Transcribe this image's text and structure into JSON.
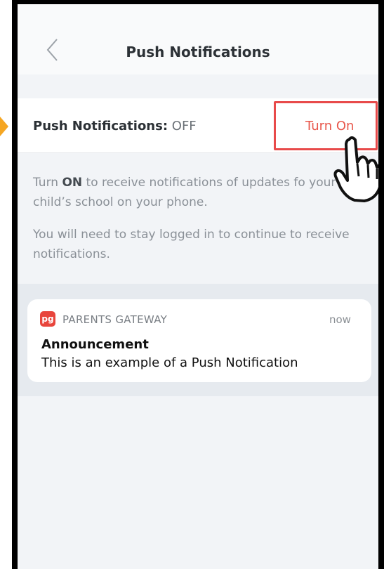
{
  "header": {
    "title": "Push Notifications"
  },
  "setting": {
    "label": "Push Notifications:",
    "status": "OFF",
    "action": "Turn On"
  },
  "description": {
    "line1_prefix": "Turn ",
    "line1_bold": "ON",
    "line1_suffix": " to receive notifications of updates fo your child’s school on your phone.",
    "line2": "You will need to stay logged in to continue to receive notifications."
  },
  "notification": {
    "app_icon_text": "pg",
    "app_name": "PARENTS GATEWAY",
    "time": "now",
    "title": "Announcement",
    "body": "This is an example of a Push Notification"
  },
  "colors": {
    "accent": "#e8574b",
    "highlight_border": "#e84a4a",
    "arrow": "#f5a623",
    "app_icon": "#e8453c"
  },
  "icons": {
    "back": "chevron-left-icon",
    "pointer": "hand-pointer-icon"
  }
}
